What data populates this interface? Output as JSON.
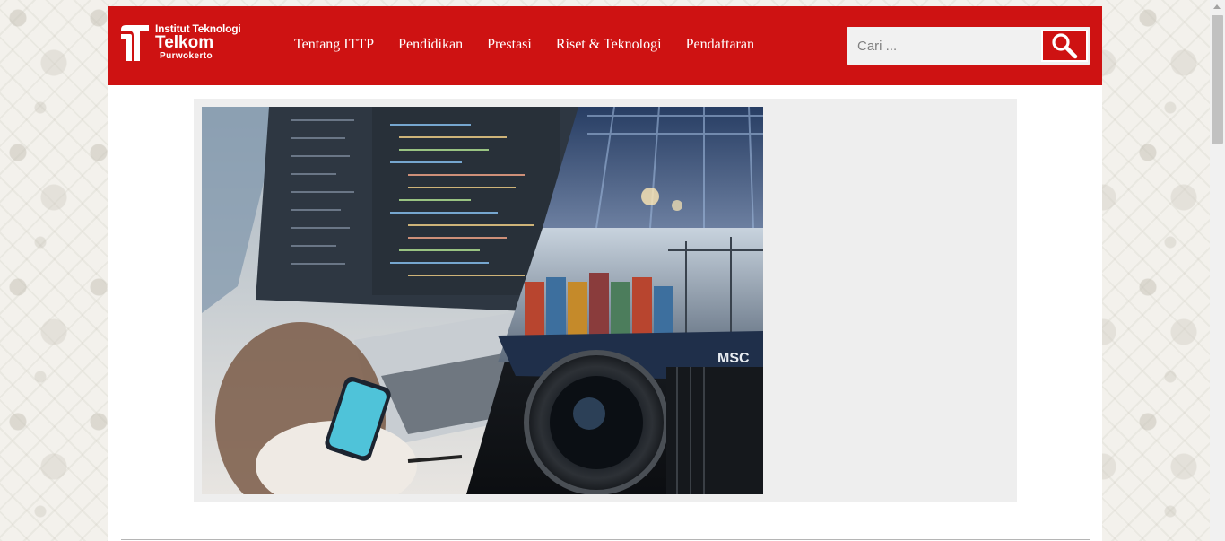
{
  "brand": {
    "line1": "Institut Teknologi",
    "line2": "Telkom",
    "line3": "Purwokerto",
    "logo_icon": "ittp-logo-icon"
  },
  "nav": {
    "items": [
      {
        "label": "Tentang ITTP"
      },
      {
        "label": "Pendidikan"
      },
      {
        "label": "Prestasi"
      },
      {
        "label": "Riset & Teknologi"
      },
      {
        "label": "Pendaftaran"
      }
    ]
  },
  "search": {
    "placeholder": "Cari ...",
    "value": "",
    "icon": "search-icon"
  },
  "featured": {
    "image_icon": "featured-banner-image"
  },
  "colors": {
    "brand_red": "#ce1212",
    "page_bg": "#ffffff",
    "panel_bg": "#eeeeee",
    "nav_text": "#ffffff"
  }
}
